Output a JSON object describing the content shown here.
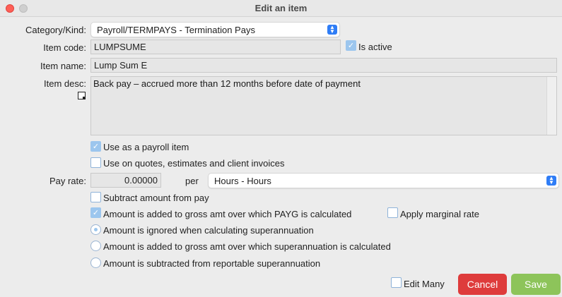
{
  "window": {
    "title": "Edit an item"
  },
  "form": {
    "category_label": "Category/Kind:",
    "category_value": "Payroll/TERMPAYS - Termination Pays",
    "item_code_label": "Item code:",
    "item_code_value": "LUMPSUME",
    "is_active_label": "Is active",
    "is_active_checked": true,
    "item_name_label": "Item name:",
    "item_name_value": "Lump Sum E",
    "item_desc_label": "Item desc:",
    "item_desc_value": "Back pay – accrued more than 12 months before date of payment",
    "use_payroll_label": "Use as a payroll item",
    "use_payroll_checked": true,
    "use_quotes_label": "Use on quotes, estimates and client invoices",
    "use_quotes_checked": false,
    "pay_rate_label": "Pay rate:",
    "pay_rate_value": "0.00000",
    "per_label": "per",
    "per_unit_value": "Hours - Hours",
    "subtract_label": "Subtract amount from pay",
    "subtract_checked": false,
    "payg_label": "Amount is added to gross amt over which PAYG is calculated",
    "payg_checked": true,
    "marginal_label": "Apply marginal rate",
    "marginal_checked": false,
    "super_options": [
      "Amount is ignored when calculating superannuation",
      "Amount is added to gross amt over which superannuation is calculated",
      "Amount is subtracted from reportable superannuation"
    ],
    "super_selected_index": 0
  },
  "footer": {
    "edit_many_label": "Edit Many",
    "edit_many_checked": false,
    "cancel_label": "Cancel",
    "save_label": "Save"
  },
  "colors": {
    "cancel": "#de3b3b",
    "save": "#8dc45a",
    "accent": "#2f7df6",
    "checked": "#9cc6ee"
  }
}
